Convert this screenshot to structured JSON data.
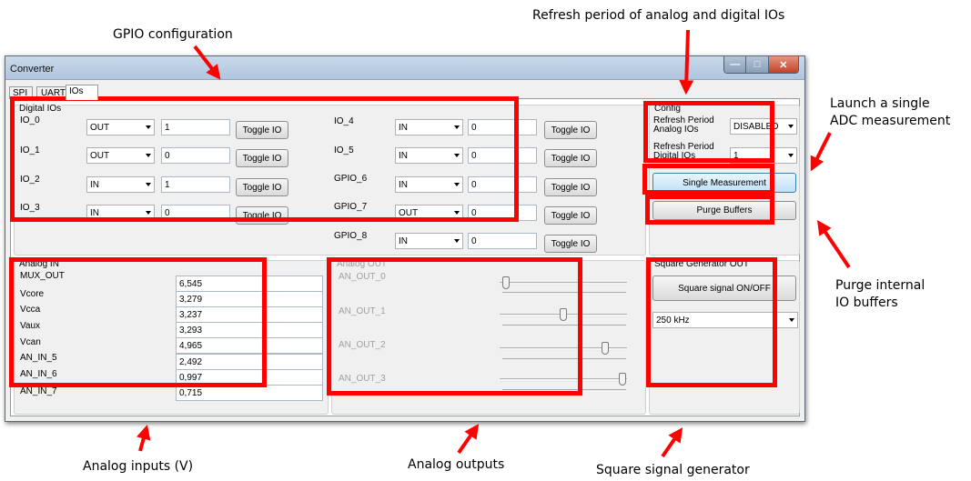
{
  "annotations": {
    "gpio": "GPIO configuration",
    "refresh": "Refresh period of analog and digital IOs",
    "single_line1": "Launch a single",
    "single_line2": "ADC measurement",
    "purge_line1": "Purge internal",
    "purge_line2": "IO buffers",
    "analog_inputs": "Analog inputs (V)",
    "analog_outputs": "Analog outputs",
    "square": "Square signal generator"
  },
  "window": {
    "title": "Converter",
    "tabs": [
      "SPI",
      "UART",
      "IOs"
    ]
  },
  "digital": {
    "title": "Digital IOs",
    "toggle_label": "Toggle IO",
    "rows": [
      {
        "name": "IO_0",
        "dir": "OUT",
        "value": "1"
      },
      {
        "name": "IO_1",
        "dir": "OUT",
        "value": "0"
      },
      {
        "name": "IO_2",
        "dir": "IN",
        "value": "1"
      },
      {
        "name": "IO_3",
        "dir": "IN",
        "value": "0"
      },
      {
        "name": "IO_4",
        "dir": "IN",
        "value": "0"
      },
      {
        "name": "IO_5",
        "dir": "IN",
        "value": "0"
      },
      {
        "name": "GPIO_6",
        "dir": "IN",
        "value": "0"
      },
      {
        "name": "GPIO_7",
        "dir": "OUT",
        "value": "0"
      },
      {
        "name": "GPIO_8",
        "dir": "IN",
        "value": "0"
      }
    ]
  },
  "config": {
    "title": "Config",
    "refresh_analog_label1": "Refresh Period",
    "refresh_analog_label2": "Analog IOs",
    "refresh_analog_value": "DISABLED",
    "refresh_digital_label1": "Refresh Period",
    "refresh_digital_label2": "Digital IOs",
    "refresh_digital_value": "1",
    "single_button": "Single Measurement",
    "purge_button": "Purge Buffers"
  },
  "analog_in": {
    "title": "Analog IN",
    "rows": [
      {
        "name": "MUX_OUT",
        "value": "6,545"
      },
      {
        "name": "Vcore",
        "value": "3,279"
      },
      {
        "name": "Vcca",
        "value": "3,237"
      },
      {
        "name": "Vaux",
        "value": "3,293"
      },
      {
        "name": "Vcan",
        "value": "4,965"
      },
      {
        "name": "AN_IN_5",
        "value": "2,492"
      },
      {
        "name": "AN_IN_6",
        "value": "0,997"
      },
      {
        "name": "AN_IN_7",
        "value": "0,715"
      }
    ]
  },
  "analog_out": {
    "title": "Analog OUT",
    "channels": [
      {
        "name": "AN_OUT_0",
        "level": 0.02
      },
      {
        "name": "AN_OUT_1",
        "level": 0.5
      },
      {
        "name": "AN_OUT_2",
        "level": 0.85
      },
      {
        "name": "AN_OUT_3",
        "level": 0.99
      }
    ]
  },
  "square": {
    "title": "Square Generator OUT",
    "button": "Square signal ON/OFF",
    "frequency": "250 kHz"
  }
}
